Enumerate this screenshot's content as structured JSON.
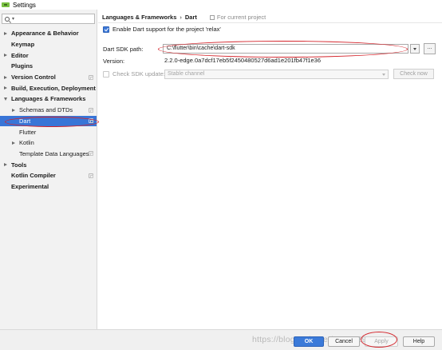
{
  "window": {
    "title": "Settings"
  },
  "search": {
    "value": ""
  },
  "tree": [
    {
      "label": "Appearance & Behavior",
      "bold": true,
      "arrow": "right",
      "proj": false
    },
    {
      "label": "Keymap",
      "bold": true,
      "arrow": "",
      "proj": false
    },
    {
      "label": "Editor",
      "bold": true,
      "arrow": "right",
      "proj": false
    },
    {
      "label": "Plugins",
      "bold": true,
      "arrow": "",
      "proj": false
    },
    {
      "label": "Version Control",
      "bold": true,
      "arrow": "right",
      "proj": true
    },
    {
      "label": "Build, Execution, Deployment",
      "bold": true,
      "arrow": "right",
      "proj": false
    },
    {
      "label": "Languages & Frameworks",
      "bold": true,
      "arrow": "down",
      "proj": false
    },
    {
      "label": "Schemas and DTDs",
      "bold": false,
      "arrow": "right",
      "proj": true,
      "indent": 1
    },
    {
      "label": "Dart",
      "bold": false,
      "arrow": "",
      "proj": true,
      "indent": 1,
      "selected": true
    },
    {
      "label": "Flutter",
      "bold": false,
      "arrow": "",
      "proj": false,
      "indent": 1
    },
    {
      "label": "Kotlin",
      "bold": false,
      "arrow": "right",
      "proj": false,
      "indent": 1
    },
    {
      "label": "Template Data Languages",
      "bold": false,
      "arrow": "",
      "proj": true,
      "indent": 1
    },
    {
      "label": "Tools",
      "bold": true,
      "arrow": "right",
      "proj": false
    },
    {
      "label": "Kotlin Compiler",
      "bold": true,
      "arrow": "",
      "proj": true
    },
    {
      "label": "Experimental",
      "bold": true,
      "arrow": "",
      "proj": false
    }
  ],
  "breadcrumb": {
    "parent": "Languages & Frameworks",
    "separator": "›",
    "current": "Dart",
    "scope": "For current project"
  },
  "dart": {
    "enable_label": "Enable Dart support for the project 'relax'",
    "enable_checked": true,
    "sdk_path_label": "Dart SDK path:",
    "sdk_path_value": "C:\\flutter\\bin\\cache\\dart-sdk",
    "browse_label": "...",
    "version_label": "Version:",
    "version_value": "2.2.0-edge.0a7dcf17eb5f2450480527d6ad1e201fb47f1e36",
    "check_update_label": "Check SDK update:",
    "check_update_checked": false,
    "channel_value": "Stable channel",
    "check_now_label": "Check now"
  },
  "footer": {
    "watermark": "https://blog.csdn.net/qq_36291322",
    "ok_label": "OK",
    "cancel_label": "Cancel",
    "apply_label": "Apply",
    "help_label": "Help"
  },
  "colors": {
    "selection": "#3875d7",
    "annotation": "#d4242b",
    "primary_button": "#3b7ad9"
  }
}
